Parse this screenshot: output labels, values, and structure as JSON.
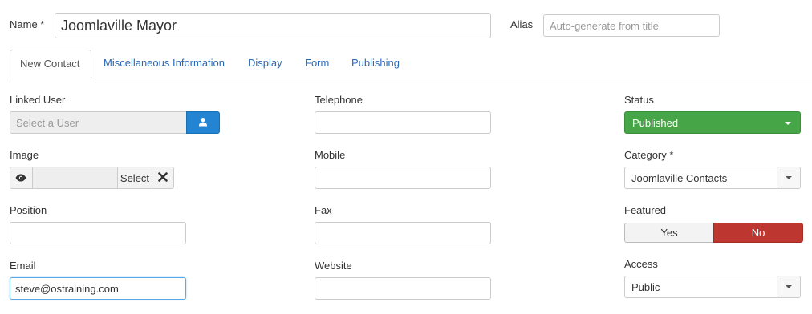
{
  "header": {
    "name_label": "Name *",
    "name_value": "Joomlaville Mayor",
    "alias_label": "Alias",
    "alias_placeholder": "Auto-generate from title"
  },
  "tabs": [
    {
      "label": "New Contact",
      "active": true
    },
    {
      "label": "Miscellaneous Information",
      "active": false
    },
    {
      "label": "Display",
      "active": false
    },
    {
      "label": "Form",
      "active": false
    },
    {
      "label": "Publishing",
      "active": false
    }
  ],
  "left": {
    "linked_user_label": "Linked User",
    "linked_user_placeholder": "Select a User",
    "user_icon": "user-icon",
    "image_label": "Image",
    "image_preview_icon": "eye-icon",
    "image_select_label": "Select",
    "image_clear_icon": "close-icon",
    "position_label": "Position",
    "position_value": "",
    "email_label": "Email",
    "email_value": "steve@ostraining.com"
  },
  "middle": {
    "telephone_label": "Telephone",
    "telephone_value": "",
    "mobile_label": "Mobile",
    "mobile_value": "",
    "fax_label": "Fax",
    "fax_value": "",
    "website_label": "Website",
    "website_value": ""
  },
  "right": {
    "status_label": "Status",
    "status_value": "Published",
    "category_label": "Category *",
    "category_value": "Joomlaville Contacts",
    "featured_label": "Featured",
    "featured_yes": "Yes",
    "featured_no": "No",
    "featured_selected": "No",
    "access_label": "Access",
    "access_value": "Public"
  },
  "colors": {
    "link": "#2a69b8",
    "status_green": "#46a546",
    "no_red": "#bd362f",
    "user_button_blue": "#2384d3",
    "focus_border": "#5aa8e8"
  }
}
